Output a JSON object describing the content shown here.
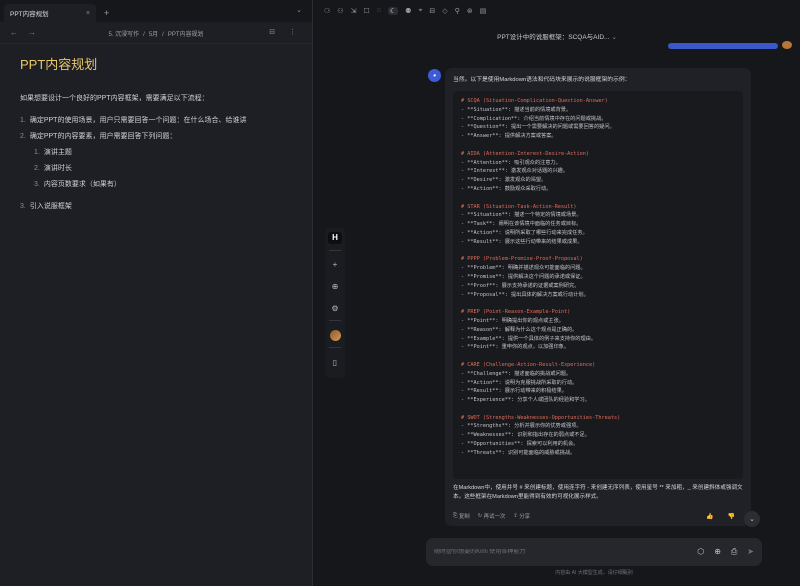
{
  "tab": {
    "title": "PPT内容规划",
    "close": "×",
    "add": "+",
    "menu": "⌄"
  },
  "nav": {
    "back": "←",
    "forward": "→",
    "crumb": [
      "5. 沉浸写作",
      "5月",
      "PPT内容规划"
    ],
    "sep": "/",
    "icons": "⊟ ⋮"
  },
  "note": {
    "title": "PPT内容规划",
    "intro": "如果想要设计一个良好的PPT内容框架，需要满足以下流程：",
    "items": [
      {
        "num": "1.",
        "text": "确定PPT的使用场景，用户只需要回答一个问题：在什么场合、给谁讲"
      },
      {
        "num": "2.",
        "text": "确定PPT的内容要素，用户需要回答下列问题："
      }
    ],
    "sub": [
      {
        "num": "1.",
        "text": "演讲主题"
      },
      {
        "num": "2.",
        "text": "演讲时长"
      },
      {
        "num": "3.",
        "text": "内容页数要求（如果有）"
      }
    ],
    "item3": {
      "num": "3.",
      "text": "引入说服框架"
    }
  },
  "midbar": {
    "logo": "H",
    "icons": [
      "+",
      "⊕",
      "⚙"
    ]
  },
  "chat": {
    "toolbar": [
      "⚆",
      "⚇",
      "⇲",
      "☐",
      "◌",
      "☾",
      "⚉",
      "⌖",
      "⊟",
      "◇",
      "⚲",
      "⊛",
      "▤"
    ],
    "title": "PPT设计中的说服框架：SCQA与AID...",
    "title_caret": "⌄",
    "bot_avatar": "◕",
    "intro": "当然。以下是使用Markdown语法和代码块来展示的说服框架的示例：",
    "code": [
      {
        "h": "# SCQA (Situation-Complication-Question-Answer)"
      },
      {
        "l": "- **Situation**: 描述当前的情境或背景。"
      },
      {
        "l": "- **Complication**: 介绍当前情境中存在的问题或挑战。"
      },
      {
        "l": "- **Question**: 提出一个需要解决的问题或需要回答的疑问。"
      },
      {
        "l": "- **Answer**: 提供解决方案或答案。"
      },
      {
        "gap": true
      },
      {
        "h": "# AIDA (Attention-Interest-Desire-Action)"
      },
      {
        "l": "- **Attention**: 吸引观众的注意力。"
      },
      {
        "l": "- **Interest**: 激发观众对话题的兴趣。"
      },
      {
        "l": "- **Desire**: 激发观众的渴望。"
      },
      {
        "l": "- **Action**: 鼓励观众采取行动。"
      },
      {
        "gap": true
      },
      {
        "h": "# STAR (Situation-Task-Action-Result)"
      },
      {
        "l": "- **Situation**: 描述一个特定的情境或场景。"
      },
      {
        "l": "- **Task**: 阐明在该情境中面临的任务或目标。"
      },
      {
        "l": "- **Action**: 说明所采取了哪些行动来完成任务。"
      },
      {
        "l": "- **Result**: 展示这些行动带来的结果或成果。"
      },
      {
        "gap": true
      },
      {
        "h": "# PPPP (Problem-Promise-Proof-Proposal)"
      },
      {
        "l": "- **Problem**: 明确并描述观众可能面临的问题。"
      },
      {
        "l": "- **Promise**: 提供解决这个问题的承诺或保证。"
      },
      {
        "l": "- **Proof**: 展示支持承诺的证据或案例研究。"
      },
      {
        "l": "- **Proposal**: 提出具体的解决方案或行动计划。"
      },
      {
        "gap": true
      },
      {
        "h": "# PREP (Point-Reason-Example-Point)"
      },
      {
        "l": "- **Point**: 明确提出你的观点或主张。"
      },
      {
        "l": "- **Reason**: 解释为什么这个观点是正确的。"
      },
      {
        "l": "- **Example**: 提供一个具体的例子来支持你的理由。"
      },
      {
        "l": "- **Point**: 重申你的观点，以加强印象。"
      },
      {
        "gap": true
      },
      {
        "h": "# CARE (Challenge-Action-Result-Experience)"
      },
      {
        "l": "- **Challenge**: 描述面临的挑战或问题。"
      },
      {
        "l": "- **Action**: 说明为克服挑战所采取的行动。"
      },
      {
        "l": "- **Result**: 展示行动带来的积极结果。"
      },
      {
        "l": "- **Experience**: 分享个人或团队的经验和学习。"
      },
      {
        "gap": true
      },
      {
        "h": "# SWOT (Strengths-Weaknesses-Opportunities-Threats)"
      },
      {
        "l": "- **Strengths**: 分析并展示你的优势或强项。"
      },
      {
        "l": "- **Weaknesses**: 识别和指出存在的弱点或不足。"
      },
      {
        "l": "- **Opportunities**: 探索可以利用的机会。"
      },
      {
        "l": "- **Threats**: 识别可能面临的威胁或挑战。"
      }
    ],
    "outro": "在Markdown中，使用井号 # 来创建标题，使用连字符 - 来创建无序列表，使用星号 ** 来加粗，_ 来创建斜体或强调文本。这些框架在Markdown里能得到有效的可视化展示样式。",
    "actions": {
      "copy": "复制",
      "regen": "再试一次",
      "share": "分享"
    },
    "copy_icon": "⎘",
    "regen_icon": "↻",
    "share_icon": "⇪",
    "thumbs": "👍 👎",
    "scroll_down": "⌄",
    "input_placeholder": "随时@你想要的Kimi 使用各种能力",
    "input_icons": [
      "⬡",
      "⊕",
      "⎙",
      "➤"
    ],
    "disclaimer": "内容由 AI 大模型生成，请仔细甄别"
  }
}
